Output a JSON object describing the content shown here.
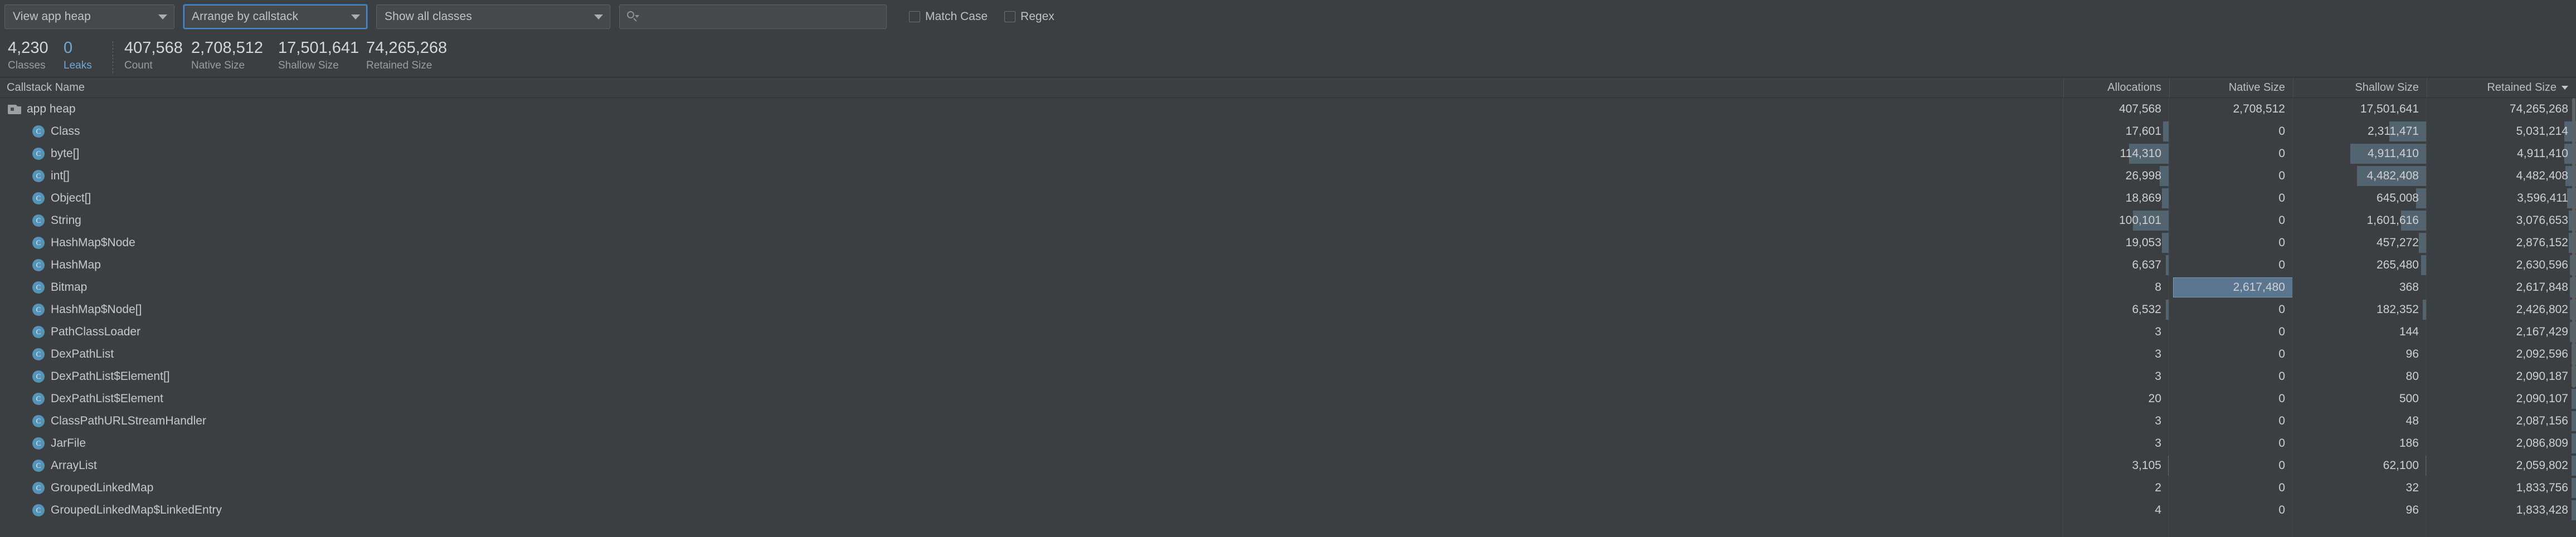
{
  "toolbar": {
    "heap_select": {
      "value": "View app heap",
      "icon": "chevron-down-icon"
    },
    "arrange_select": {
      "value": "Arrange by callstack",
      "icon": "chevron-down-icon"
    },
    "classes_select": {
      "value": "Show all classes",
      "icon": "chevron-down-icon"
    },
    "search": {
      "value": "",
      "placeholder": "",
      "icon": "search-icon"
    },
    "match_case": {
      "label": "Match Case",
      "checked": false
    },
    "regex": {
      "label": "Regex",
      "checked": false
    }
  },
  "stats": [
    {
      "value": "4,230",
      "label": "Classes",
      "accent": false
    },
    {
      "value": "0",
      "label": "Leaks",
      "accent": true
    },
    {
      "value": "407,568",
      "label": "Count",
      "accent": false
    },
    {
      "value": "2,708,512",
      "label": "Native Size",
      "accent": false
    },
    {
      "value": "17,501,641",
      "label": "Shallow Size",
      "accent": false
    },
    {
      "value": "74,265,268",
      "label": "Retained Size",
      "accent": false
    }
  ],
  "table": {
    "columns": {
      "name": "Callstack Name",
      "allocations": "Allocations",
      "native_size": "Native Size",
      "shallow_size": "Shallow Size",
      "retained_size": "Retained Size"
    },
    "sorted_by": "Retained Size",
    "sort_direction": "descending",
    "rows": [
      {
        "name": "app heap",
        "icon": "folder-icon",
        "depth": 0,
        "allocations": "407,568",
        "native_size": "2,708,512",
        "shallow_size": "17,501,641",
        "retained_size": "74,265,268",
        "bar_alloc": 0,
        "bar_native": 0,
        "bar_shallow": 0,
        "bar_retained": 0
      },
      {
        "name": "Class",
        "icon": "class-icon",
        "depth": 1,
        "allocations": "17,601",
        "native_size": "0",
        "shallow_size": "2,311,471",
        "retained_size": "5,031,214",
        "bar_alloc": 6,
        "bar_native": 0,
        "bar_shallow": 28,
        "bar_retained": 8
      },
      {
        "name": "byte[]",
        "icon": "class-icon",
        "depth": 1,
        "allocations": "114,310",
        "native_size": "0",
        "shallow_size": "4,911,410",
        "retained_size": "4,911,410",
        "bar_alloc": 38,
        "bar_native": 0,
        "bar_shallow": 57,
        "bar_retained": 8
      },
      {
        "name": "int[]",
        "icon": "class-icon",
        "depth": 1,
        "allocations": "26,998",
        "native_size": "0",
        "shallow_size": "4,482,408",
        "retained_size": "4,482,408",
        "bar_alloc": 9,
        "bar_native": 0,
        "bar_shallow": 52,
        "bar_retained": 7
      },
      {
        "name": "Object[]",
        "icon": "class-icon",
        "depth": 1,
        "allocations": "18,869",
        "native_size": "0",
        "shallow_size": "645,008",
        "retained_size": "3,596,411",
        "bar_alloc": 7,
        "bar_native": 0,
        "bar_shallow": 8,
        "bar_retained": 6
      },
      {
        "name": "String",
        "icon": "class-icon",
        "depth": 1,
        "allocations": "100,101",
        "native_size": "0",
        "shallow_size": "1,601,616",
        "retained_size": "3,076,653",
        "bar_alloc": 34,
        "bar_native": 0,
        "bar_shallow": 19,
        "bar_retained": 5
      },
      {
        "name": "HashMap$Node",
        "icon": "class-icon",
        "depth": 1,
        "allocations": "19,053",
        "native_size": "0",
        "shallow_size": "457,272",
        "retained_size": "2,876,152",
        "bar_alloc": 7,
        "bar_native": 0,
        "bar_shallow": 6,
        "bar_retained": 5
      },
      {
        "name": "HashMap",
        "icon": "class-icon",
        "depth": 1,
        "allocations": "6,637",
        "native_size": "0",
        "shallow_size": "265,480",
        "retained_size": "2,630,596",
        "bar_alloc": 3,
        "bar_native": 0,
        "bar_shallow": 4,
        "bar_retained": 4
      },
      {
        "name": "Bitmap",
        "icon": "class-icon",
        "depth": 1,
        "allocations": "8",
        "native_size": "2,617,480",
        "shallow_size": "368",
        "retained_size": "2,617,848",
        "bar_alloc": 0,
        "bar_native": 97,
        "bar_shallow": 0,
        "bar_retained": 4
      },
      {
        "name": "HashMap$Node[]",
        "icon": "class-icon",
        "depth": 1,
        "allocations": "6,532",
        "native_size": "0",
        "shallow_size": "182,352",
        "retained_size": "2,426,802",
        "bar_alloc": 3,
        "bar_native": 0,
        "bar_shallow": 3,
        "bar_retained": 4
      },
      {
        "name": "PathClassLoader",
        "icon": "class-icon",
        "depth": 1,
        "allocations": "3",
        "native_size": "0",
        "shallow_size": "144",
        "retained_size": "2,167,429",
        "bar_alloc": 0,
        "bar_native": 0,
        "bar_shallow": 0,
        "bar_retained": 4
      },
      {
        "name": "DexPathList",
        "icon": "class-icon",
        "depth": 1,
        "allocations": "3",
        "native_size": "0",
        "shallow_size": "96",
        "retained_size": "2,092,596",
        "bar_alloc": 0,
        "bar_native": 0,
        "bar_shallow": 0,
        "bar_retained": 3
      },
      {
        "name": "DexPathList$Element[]",
        "icon": "class-icon",
        "depth": 1,
        "allocations": "3",
        "native_size": "0",
        "shallow_size": "80",
        "retained_size": "2,090,187",
        "bar_alloc": 0,
        "bar_native": 0,
        "bar_shallow": 0,
        "bar_retained": 3
      },
      {
        "name": "DexPathList$Element",
        "icon": "class-icon",
        "depth": 1,
        "allocations": "20",
        "native_size": "0",
        "shallow_size": "500",
        "retained_size": "2,090,107",
        "bar_alloc": 0,
        "bar_native": 0,
        "bar_shallow": 0,
        "bar_retained": 3
      },
      {
        "name": "ClassPathURLStreamHandler",
        "icon": "class-icon",
        "depth": 1,
        "allocations": "3",
        "native_size": "0",
        "shallow_size": "48",
        "retained_size": "2,087,156",
        "bar_alloc": 0,
        "bar_native": 0,
        "bar_shallow": 0,
        "bar_retained": 3
      },
      {
        "name": "JarFile",
        "icon": "class-icon",
        "depth": 1,
        "allocations": "3",
        "native_size": "0",
        "shallow_size": "186",
        "retained_size": "2,086,809",
        "bar_alloc": 0,
        "bar_native": 0,
        "bar_shallow": 0,
        "bar_retained": 3
      },
      {
        "name": "ArrayList",
        "icon": "class-icon",
        "depth": 1,
        "allocations": "3,105",
        "native_size": "0",
        "shallow_size": "62,100",
        "retained_size": "2,059,802",
        "bar_alloc": 1,
        "bar_native": 0,
        "bar_shallow": 1,
        "bar_retained": 3
      },
      {
        "name": "GroupedLinkedMap",
        "icon": "class-icon",
        "depth": 1,
        "allocations": "2",
        "native_size": "0",
        "shallow_size": "32",
        "retained_size": "1,833,756",
        "bar_alloc": 0,
        "bar_native": 0,
        "bar_shallow": 0,
        "bar_retained": 3
      },
      {
        "name": "GroupedLinkedMap$LinkedEntry",
        "icon": "class-icon",
        "depth": 1,
        "allocations": "4",
        "native_size": "0",
        "shallow_size": "96",
        "retained_size": "1,833,428",
        "bar_alloc": 0,
        "bar_native": 0,
        "bar_shallow": 0,
        "bar_retained": 3
      }
    ]
  }
}
